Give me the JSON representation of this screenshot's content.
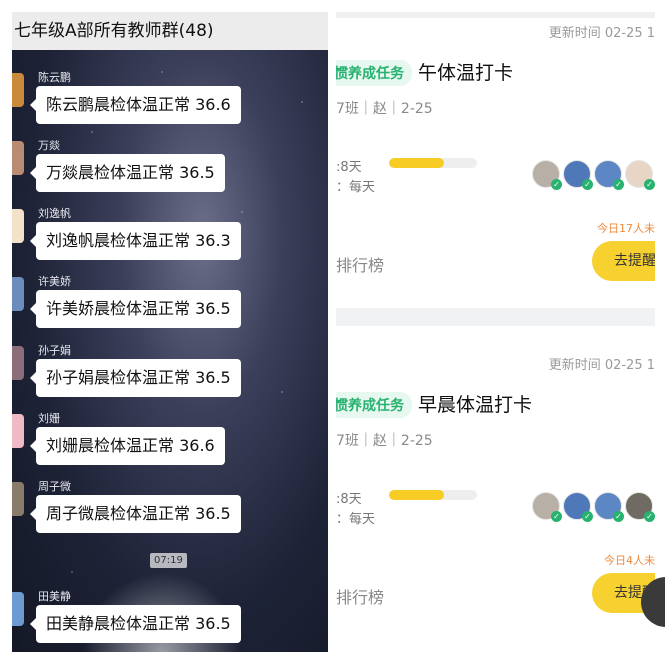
{
  "chat": {
    "title": "七年级A部所有教师群(48)",
    "timestamp": "07:19",
    "messages": [
      {
        "sender": "陈云鹏",
        "text": "陈云鹏晨检体温正常 36.6",
        "avatar_color": "#c98b3a"
      },
      {
        "sender": "万燚",
        "text": "万燚晨检体温正常 36.5",
        "avatar_color": "#b98b73"
      },
      {
        "sender": "刘逸帆",
        "text": "刘逸帆晨检体温正常 36.3",
        "avatar_color": "#f4e2c8"
      },
      {
        "sender": "许美娇",
        "text": "许美娇晨检体温正常 36.5",
        "avatar_color": "#6c8dbb"
      },
      {
        "sender": "孙子娟",
        "text": "孙子娟晨检体温正常 36.5",
        "avatar_color": "#8c6e7a"
      },
      {
        "sender": "刘姗",
        "text": "刘姗晨检体温正常 36.6",
        "avatar_color": "#f0b9c6"
      },
      {
        "sender": "周子微",
        "text": "周子微晨检体温正常 36.5",
        "avatar_color": "#8a7c6a"
      },
      {
        "sender": "田美静",
        "text": "田美静晨检体温正常 36.5",
        "avatar_color": "#6d9bd1"
      }
    ]
  },
  "tasks": [
    {
      "updated": "更新时间 02-25 1",
      "tag": "惯养成任务",
      "title": "午体温打卡",
      "meta": "7班｜赵｜2-25",
      "streak": ":8天",
      "freq": "：每天",
      "progress": 0.62,
      "avatars": [
        "#b8b0a6",
        "#4e78b8",
        "#5c86c4",
        "#e7d6c6"
      ],
      "remaining": "今日17人未",
      "rank_label": "排行榜",
      "remind_label": "去提醒"
    },
    {
      "updated": "更新时间 02-25 1",
      "tag": "惯养成任务",
      "title": "早晨体温打卡",
      "meta": "7班｜赵｜2-25",
      "streak": ":8天",
      "freq": "：每天",
      "progress": 0.62,
      "avatars": [
        "#b8b0a6",
        "#4e78b8",
        "#5c86c4",
        "#6f6b62"
      ],
      "remaining": "今日4人未",
      "rank_label": "排行榜",
      "remind_label": "去提醒"
    }
  ]
}
